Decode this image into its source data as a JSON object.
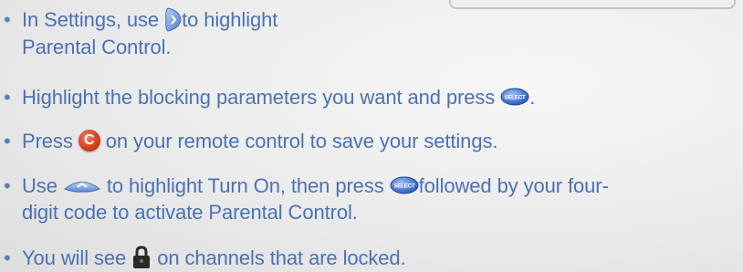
{
  "instructions": [
    {
      "before": "In Settings, use ",
      "icon": "right-arrow-icon",
      "after": "to highlight",
      "line2": "Parental Control."
    },
    {
      "before": "Highlight the blocking parameters you want and press ",
      "icon": "select-button-icon",
      "after": "."
    },
    {
      "before": "Press ",
      "icon": "c-button-icon",
      "icon_label": "C",
      "after": " on your remote control to save your settings."
    },
    {
      "before": "Use ",
      "icon": "up-arrow-icon",
      "mid": " to highlight Turn On, then press ",
      "icon2": "select-button-icon",
      "after": "followed by your four-",
      "line2": "digit code to activate Parental Control."
    },
    {
      "before": "You will see ",
      "icon": "lock-icon",
      "after": " on channels that are locked."
    }
  ],
  "select_label": "SELECT",
  "colors": {
    "text": "#4a72b4",
    "select_button": "#2f66c9",
    "c_button": "#d13c1b",
    "arrow_button": "#7fa0d8"
  }
}
